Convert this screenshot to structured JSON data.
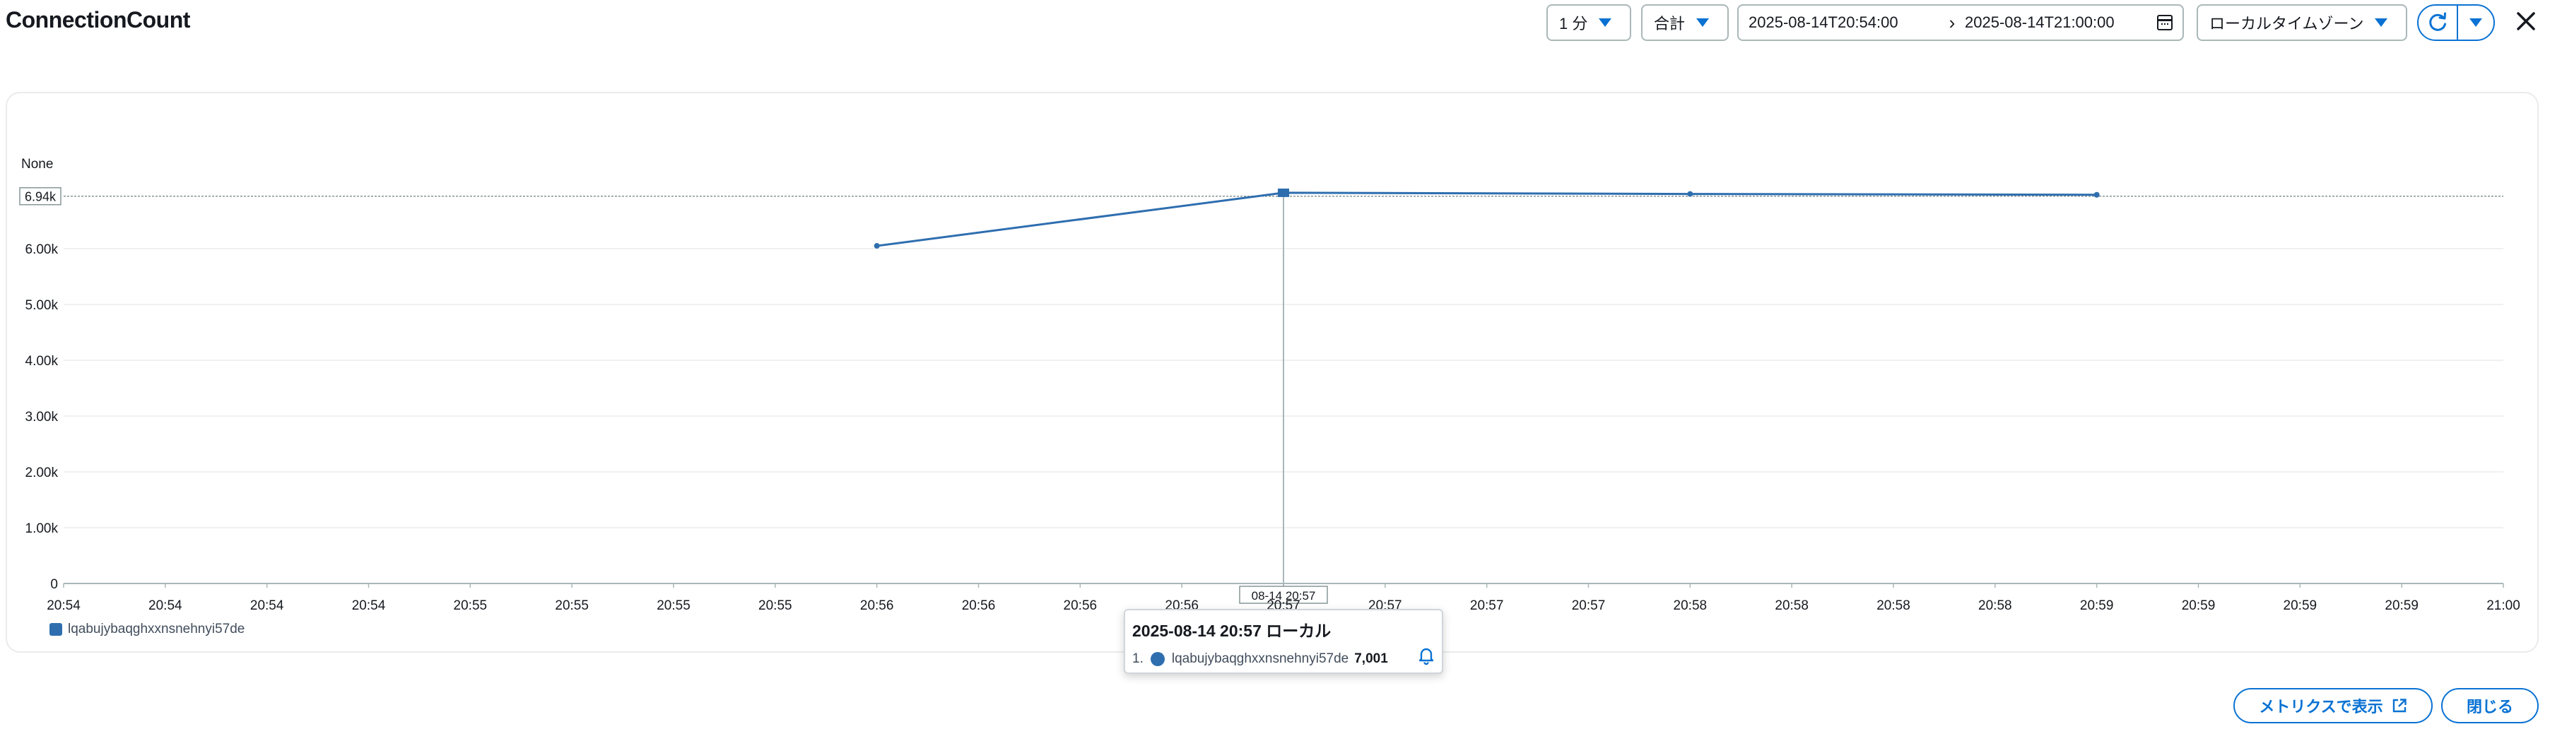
{
  "title": "ConnectionCount",
  "controls": {
    "interval": "1 分",
    "statistic": "合計",
    "range_start": "2025-08-14T20:54:00",
    "range_arrow": "›",
    "range_end": "2025-08-14T21:00:00",
    "timezone": "ローカルタイムゾーン"
  },
  "colors": {
    "accent": "#0972d3",
    "series": "#2e6eaf",
    "grid": "#e9ebed"
  },
  "chart_data": {
    "type": "line",
    "ylabel": "None",
    "ylim": [
      0,
      7000
    ],
    "yticks": [
      {
        "value": 0,
        "label": "0"
      },
      {
        "value": 1000,
        "label": "1.00k"
      },
      {
        "value": 2000,
        "label": "2.00k"
      },
      {
        "value": 3000,
        "label": "3.00k"
      },
      {
        "value": 4000,
        "label": "4.00k"
      },
      {
        "value": 5000,
        "label": "5.00k"
      },
      {
        "value": 6000,
        "label": "6.00k"
      }
    ],
    "hover_line": {
      "value": 6940,
      "label": "6.94k"
    },
    "xticks": [
      "20:54",
      "20:54",
      "20:54",
      "20:54",
      "20:55",
      "20:55",
      "20:55",
      "20:55",
      "20:56",
      "20:56",
      "20:56",
      "20:56",
      "20:57",
      "20:57",
      "20:57",
      "20:57",
      "20:58",
      "20:58",
      "20:58",
      "20:58",
      "20:59",
      "20:59",
      "20:59",
      "20:59",
      "21:00"
    ],
    "hover_x_label": "08-14 20:57",
    "grid": true,
    "legend": "bottom-left",
    "series": [
      {
        "name": "lqabujybaqghxxnsnehnyi57de",
        "x": [
          "20:56",
          "20:57",
          "20:58",
          "20:59"
        ],
        "values": [
          6050,
          7001,
          6980,
          6965
        ]
      }
    ]
  },
  "tooltip": {
    "title": "2025-08-14 20:57 ローカル",
    "index": "1.",
    "series_name": "lqabujybaqghxxnsnehnyi57de",
    "value": "7,001"
  },
  "legend": {
    "label": "lqabujybaqghxxnsnehnyi57de"
  },
  "footer": {
    "view_metrics": "メトリクスで表示",
    "close": "閉じる"
  },
  "icons": [
    "calendar-icon",
    "refresh-icon",
    "close-icon",
    "bell-icon",
    "external-link-icon"
  ]
}
